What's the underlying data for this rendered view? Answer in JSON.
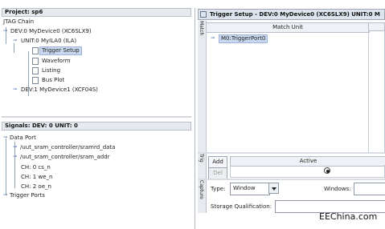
{
  "project_panel": {
    "title": "Project: sp6",
    "tree": {
      "root": "JTAG Chain",
      "device0": "DEV:0 MyDevice0 (XC6SLX9)",
      "unit0": "UNIT:0 MyILA0 (ILA)",
      "children": [
        "Trigger Setup",
        "Waveform",
        "Listing",
        "Bus Plot"
      ],
      "device1": "DEV:1 MyDevice1 (XCF04S)"
    }
  },
  "signals_panel": {
    "title": "Signals: DEV: 0 UNIT: 0",
    "data_port": "Data Port",
    "items": [
      "/uut_sram_controller/sramrd_data",
      "/uut_sram_controller/sram_addr"
    ],
    "channels": [
      "CH: 0 cs_n",
      "CH: 1 we_n",
      "CH: 2 oe_n"
    ],
    "trigger_ports": "Trigger Ports"
  },
  "trigger_window": {
    "title": "Trigger Setup - DEV:0 MyDevice0 (XC6SLX9) UNIT:0 M",
    "match_tab": "Match",
    "match_unit_header": "Match Unit",
    "match_row": "M0:TriggerPort0",
    "trig_tab": "Trig",
    "add_label": "Add",
    "del_label": "Del",
    "active_header": "Active",
    "capture_tab": "Capture",
    "type_label": "Type:",
    "type_value": "Window",
    "windows_label": "Windows:",
    "storage_label": "Storage Qualification:"
  },
  "watermark": "EEChina.com"
}
